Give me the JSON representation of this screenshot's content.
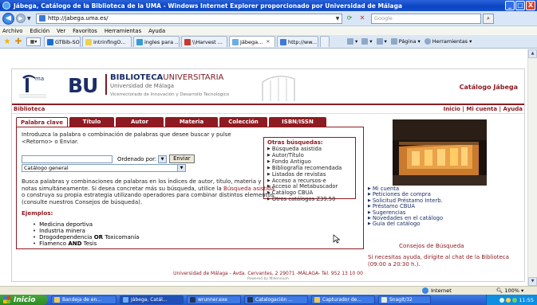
{
  "window": {
    "title": "Jábega, Catálogo de la Biblioteca de la UMA - Windows Internet Explorer proporcionado por Universidad de Málaga",
    "controls": [
      "_",
      "□",
      "X"
    ]
  },
  "addressbar": {
    "url": "http://jabega.uma.es/",
    "search_placeholder": "Google"
  },
  "menu": [
    "Archivo",
    "Edición",
    "Ver",
    "Favoritos",
    "Herramientas",
    "Ayuda"
  ],
  "tabs": [
    {
      "label": "GTBib-SOD"
    },
    {
      "label": "intrinfingO..."
    },
    {
      "label": "ingles para ..."
    },
    {
      "label": "\\\\Harvest ..."
    },
    {
      "label": "Jábega...",
      "active": true
    },
    {
      "label": "http://ww..."
    }
  ],
  "toolbar_cmds": {
    "pagina": "Página",
    "herramientas": "Herramientas"
  },
  "site": {
    "bu": "BU",
    "bib_title_1": "BIBLIOTECA",
    "bib_title_2": "UNIVERSITARIA",
    "uni": "Universidad de Málaga",
    "vicerrectorado": "Vicerrectorado de Innovación y Desarrollo Tecnológico",
    "catalog_title": "Catálogo Jábega",
    "nav_left": "Biblioteca",
    "nav_right": "Inicio | Mi cuenta | Ayuda"
  },
  "search_tabs": [
    "Palabra clave",
    "Título",
    "Autor",
    "Materia",
    "Colección",
    "ISBN/ISSN"
  ],
  "search": {
    "intro": "Introduzca la palabra o combinación de palabras que desee buscar y pulse <Retorno> o Enviar.",
    "order_label": "Ordenado por:",
    "submit": "Enviar",
    "catalog_select": "Catálogo general",
    "help_1": "Busca palabras y combinaciones de palabras en los índices de autor, título, materia y notas simultáneamente. Si desea concretar más su búsqueda, utilice la ",
    "help_link": "Búsqueda asistida",
    "help_2": " o construya su propia estrategia utilizando operadores para combinar distintos elementos (consulte nuestros Consejos de búsqueda).",
    "examples_label": "Ejemplos:",
    "examples": [
      {
        "pre": "Medicina deportiva",
        "op": "",
        "post": ""
      },
      {
        "pre": "Industria minera",
        "op": "",
        "post": ""
      },
      {
        "pre": "Drogodependencia ",
        "op": "OR",
        "post": " Toxicomanía"
      },
      {
        "pre": "Flamenco ",
        "op": "AND",
        "post": " Tesis"
      }
    ]
  },
  "other_searches": {
    "title": "Otras búsquedas:",
    "items": [
      "Búsqueda asistida",
      "Autor/Título",
      "Fondo Antiguo",
      "Bibliografía recomendada",
      "Listados de revistas",
      "Acceso a recursos-e",
      "Acceso al Metabuscador",
      "Catálogo CBUA",
      "Otros catálogos Z39.50"
    ]
  },
  "side_links": [
    "Mi cuenta",
    "Peticiones de compra",
    "Solicitud Préstamo Interb.",
    "Préstamo CBUA",
    "Sugerencias",
    "Novedades en el catálogo",
    "Guía del catálogo"
  ],
  "consejos": "Consejos de Búsqueda",
  "ayuda": "Si necesitas ayuda, dirígite al chat de la Biblioteca (09:00 a 20:30 h.).",
  "footer": "Universidad de Málaga - Avda. Cervantes, 2 29071 -MÁLAGA- Tel. 952 13 10 00",
  "powered": "Powered by Millennium",
  "status": {
    "zone": "Internet",
    "zoom": "100%"
  },
  "taskbar": {
    "start": "Inicio",
    "tasks": [
      "Bandeja de en...",
      "Jábega, Catál...",
      "wrunner.exe",
      "Catalogación ...",
      "Capturador de...",
      "SnagIt/32"
    ],
    "clock": "11:55"
  }
}
